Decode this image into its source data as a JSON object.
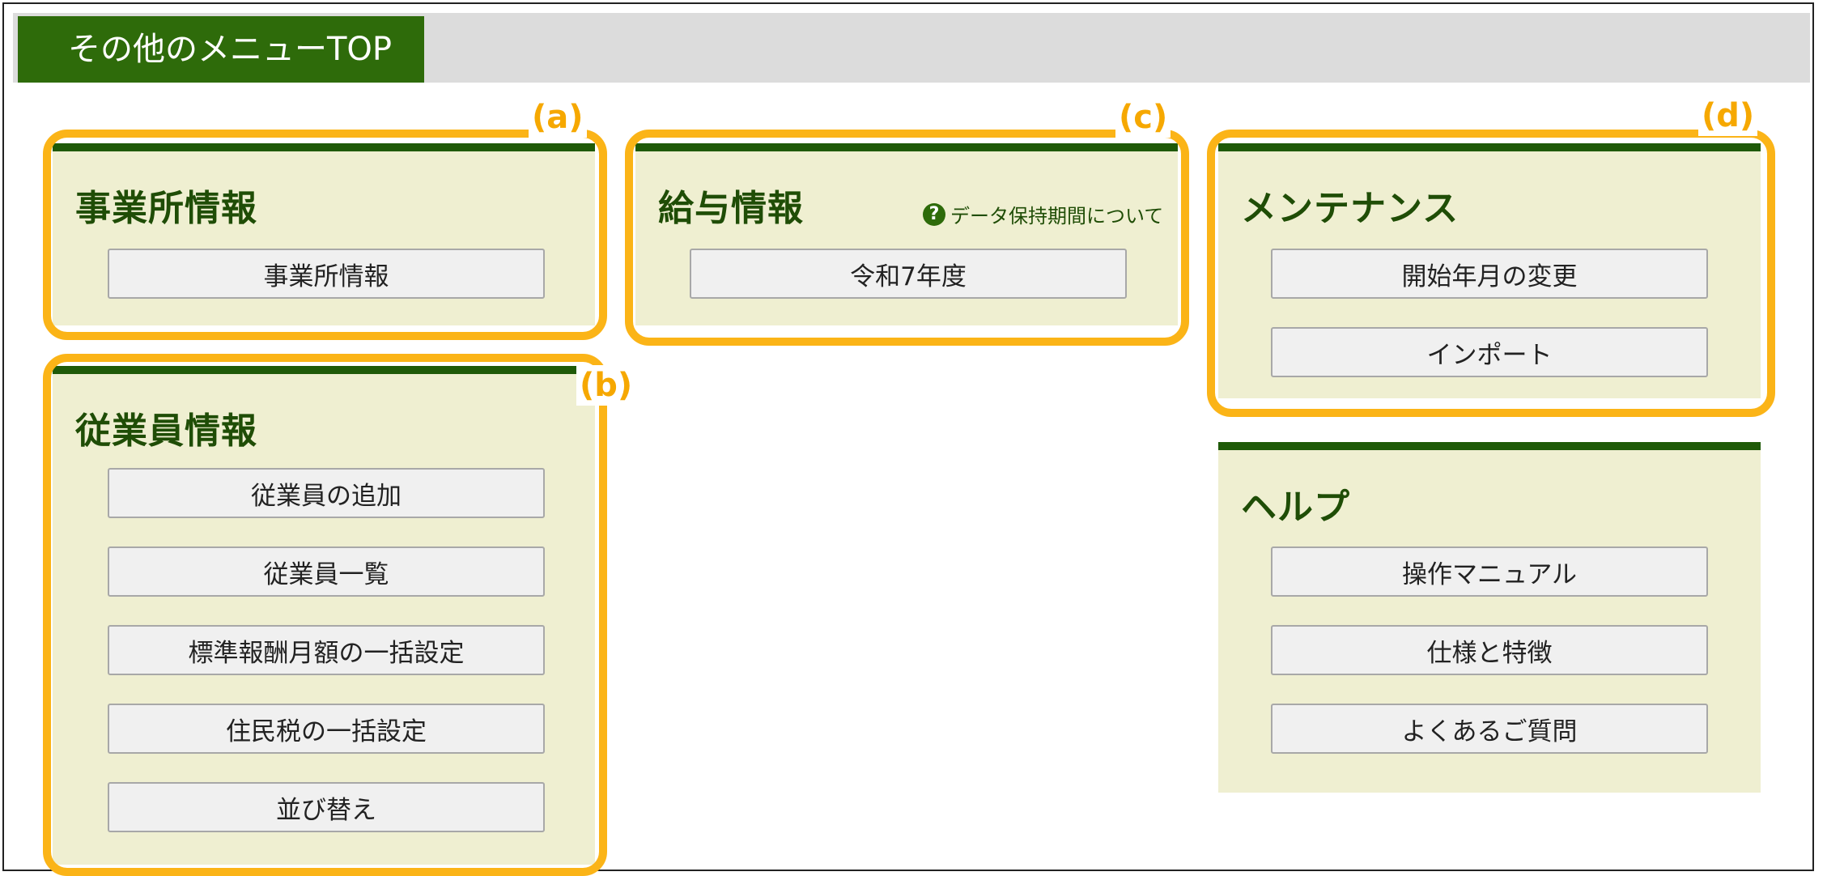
{
  "header": {
    "tab_label": "その他のメニューTOP"
  },
  "markers": {
    "a": "(a)",
    "b": "(b)",
    "c": "(c)",
    "d": "(d)"
  },
  "office": {
    "title": "事業所情報",
    "buttons": [
      "事業所情報"
    ]
  },
  "employee": {
    "title": "従業員情報",
    "buttons": [
      "従業員の追加",
      "従業員一覧",
      "標準報酬月額の一括設定",
      "住民税の一括設定",
      "並び替え"
    ]
  },
  "salary": {
    "title": "給与情報",
    "help_link": "データ保持期間について",
    "buttons": [
      "令和7年度"
    ]
  },
  "maintenance": {
    "title": "メンテナンス",
    "buttons": [
      "開始年月の変更",
      "インポート"
    ]
  },
  "help": {
    "title": "ヘルプ",
    "buttons": [
      "操作マニュアル",
      "仕様と特徴",
      "よくあるご質問"
    ]
  },
  "colors": {
    "accent": "#2e6b0a",
    "panel_bg": "#efefd1",
    "highlight": "#fbb417"
  },
  "icons": {
    "help_link_icon": "question-circle-icon"
  }
}
